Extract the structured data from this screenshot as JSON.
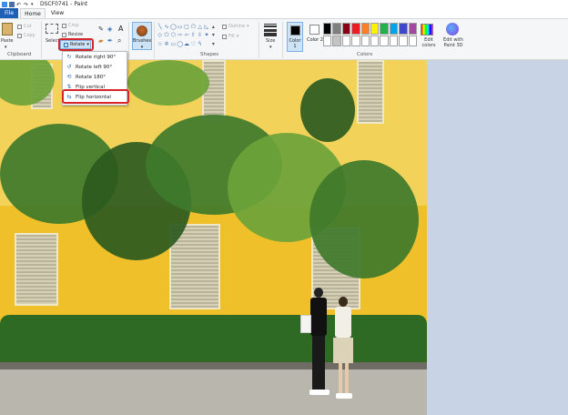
{
  "window": {
    "title": "DSCF0741 - Paint"
  },
  "tabs": {
    "file": "File",
    "home": "Home",
    "view": "View"
  },
  "ribbon": {
    "clipboard": {
      "paste": "Paste",
      "cut": "Cut",
      "copy": "Copy",
      "label": "Clipboard"
    },
    "image": {
      "select": "Select",
      "crop": "Crop",
      "resize": "Resize",
      "rotate": "Rotate"
    },
    "tools": {
      "text_icon": "A"
    },
    "brushes": "Brushes",
    "shapes": {
      "outline": "Outline",
      "fill": "Fill",
      "label": "Shapes"
    },
    "size": "Size",
    "colors": {
      "color1": "Color 1",
      "color2": "Color 2",
      "label": "Colors",
      "palette": [
        "#000000",
        "#7f7f7f",
        "#880015",
        "#ed1c24",
        "#ff7f27",
        "#fff200",
        "#22b14c",
        "#00a2e8",
        "#3f48cc",
        "#a349a4",
        "#ffffff",
        "#c3c3c3",
        "#ffffff",
        "#ffffff",
        "#ffffff",
        "#ffffff",
        "#ffffff",
        "#ffffff",
        "#ffffff",
        "#ffffff"
      ],
      "edit_colors": "Edit colors",
      "paint3d": "Edit with Paint 3D"
    }
  },
  "rotate_menu": {
    "items": [
      {
        "label": "Rotate right 90°",
        "icon": "rotate-right-icon"
      },
      {
        "label": "Rotate left 90°",
        "icon": "rotate-left-icon"
      },
      {
        "label": "Rotate 180°",
        "icon": "rotate-180-icon"
      },
      {
        "label": "Flip vertical",
        "icon": "flip-vertical-icon"
      },
      {
        "label": "Flip horizontal",
        "icon": "flip-horizontal-icon"
      }
    ]
  }
}
